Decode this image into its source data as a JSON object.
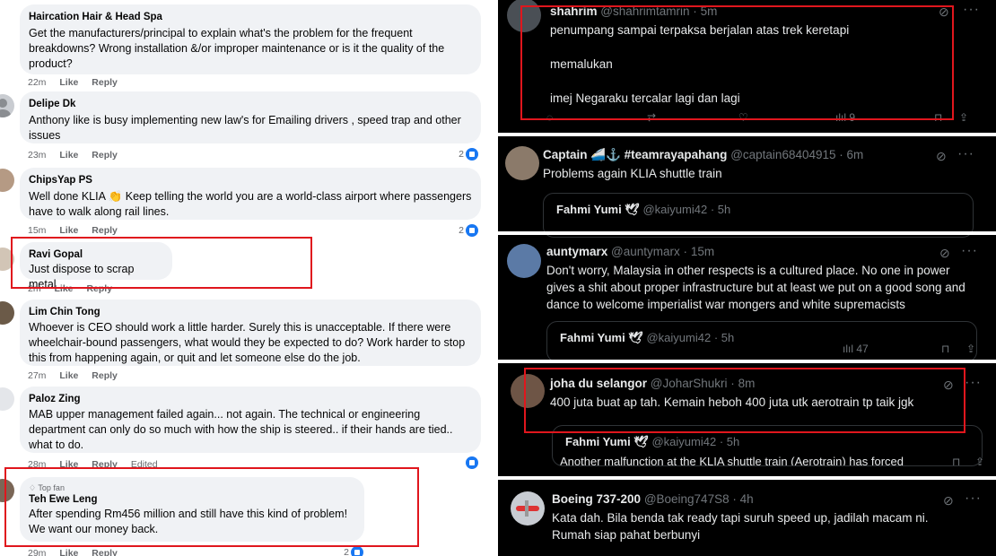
{
  "facebook": {
    "comments": [
      {
        "name": "Haircation Hair & Head Spa",
        "text": "Get the manufacturers/principal to explain what's the problem for the frequent breakdowns? Wrong installation &/or improper maintenance or is it the quality of the product?",
        "time": "22m",
        "like": "Like",
        "reply": "Reply"
      },
      {
        "name": "Delipe Dk",
        "text": "Anthony like is busy implementing new law's for Emailing drivers , speed trap and other issues",
        "time": "23m",
        "like": "Like",
        "reply": "Reply",
        "reactions": "2"
      },
      {
        "name": "ChipsYap PS",
        "text": "Well done KLIA 👏 Keep telling the world you are a world-class airport where passengers have to walk along rail lines.",
        "time": "15m",
        "like": "Like",
        "reply": "Reply",
        "reactions": "2"
      },
      {
        "name": "Ravi Gopal",
        "text": "Just dispose to scrap metal",
        "time": "2m",
        "like": "Like",
        "reply": "Reply"
      },
      {
        "name": "Lim Chin Tong",
        "text": "Whoever is CEO should work a little harder. Surely this is unacceptable. If there were wheelchair-bound passengers, what would they be expected to do? Work harder to stop this from happening again, or quit and let someone else do the job.",
        "time": "27m",
        "like": "Like",
        "reply": "Reply"
      },
      {
        "name": "Paloz Zing",
        "text": "MAB upper management failed again... not again. The technical or engineering department can only do so much with how the ship is steered.. if their hands are tied.. what to do.",
        "time": "28m",
        "like": "Like",
        "reply": "Reply",
        "edited": "Edited"
      },
      {
        "badge": "Top fan",
        "name": "Teh Ewe Leng",
        "text": "After spending Rm456 million and still have this kind of problem! We want our money back.",
        "time": "29m",
        "like": "Like",
        "reply": "Reply",
        "reactions": "2"
      }
    ]
  },
  "twitter": {
    "tweets": [
      {
        "name": "shahrim",
        "handle": "@shahrimtamrin",
        "time": "5m",
        "lines": [
          "penumpang sampai terpaksa berjalan atas trek keretapi",
          "memalukan",
          "imej Negaraku tercalar lagi dan lagi"
        ],
        "views": "9"
      },
      {
        "name": "Captain 🚄⚓ #teamrayapahang",
        "handle": "@captain68404915",
        "time": "6m",
        "text": "Problems again KLIA shuttle train",
        "quote": {
          "name": "Fahmi Yumi 🕊",
          "handle": "@kaiyumi42",
          "time": "5h"
        }
      },
      {
        "name": "auntymarx",
        "handle": "@auntymarx",
        "time": "15m",
        "text": "Don't worry, Malaysia in other respects is a cultured place. No one in power gives a shit about proper infrastructure but at least we put on a good song and dance to welcome imperialist war mongers and white supremacists",
        "quote": {
          "name": "Fahmi Yumi 🕊",
          "handle": "@kaiyumi42",
          "time": "5h"
        },
        "views": "47"
      },
      {
        "name": "joha du selangor",
        "handle": "@JoharShukri",
        "time": "8m",
        "text": "400 juta buat ap tah. Kemain heboh 400 juta utk aerotrain tp taik jgk",
        "quote": {
          "name": "Fahmi Yumi 🕊",
          "handle": "@kaiyumi42",
          "time": "5h",
          "text": "Another malfunction at the KLIA shuttle train (Aerotrain) has forced"
        }
      },
      {
        "name": "Boeing 737-200",
        "handle": "@Boeing747S8",
        "time": "4h",
        "text": "Kata dah. Bila benda tak ready tapi suruh speed up, jadilah macam ni. Rumah siap pahat berbunyi"
      }
    ]
  },
  "colors": {
    "highlight": "#e0161d",
    "fb_bubble": "#f0f2f5",
    "fb_like": "#1877f2",
    "tw_bg": "#000000"
  }
}
